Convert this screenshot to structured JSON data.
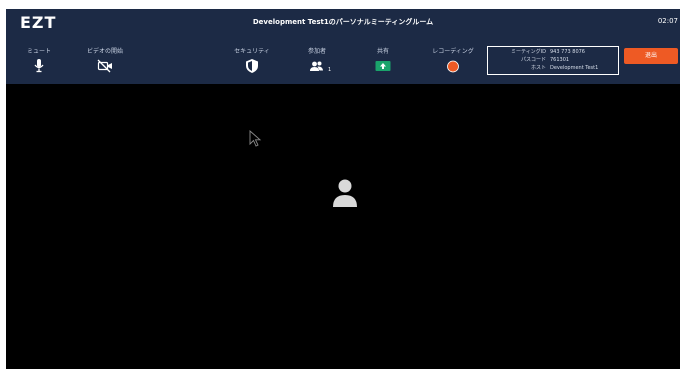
{
  "window": {
    "logo": "EZT",
    "title": "Development Test1のパーソナルミーティングルーム",
    "clock": "02:07"
  },
  "toolbar": {
    "mute_label": "ミュート",
    "video_label": "ビデオの開始",
    "security_label": "セキュリティ",
    "participants_label": "参加者",
    "participants_count": "1",
    "share_label": "共有",
    "recording_label": "レコーディング",
    "leave_label": "退出"
  },
  "meeting_info": {
    "id_key": "ミーティングID",
    "id_value": "943 773 8076",
    "passcode_key": "パスコード",
    "passcode_value": "761301",
    "host_key": "ホスト",
    "host_value": "Development Test1"
  },
  "colors": {
    "toolbar_bg": "#1c2a45",
    "stage_bg": "#000000",
    "share_green": "#1aa36b",
    "record_red": "#ee5a24",
    "leave_orange": "#ee5a24"
  },
  "icons": {
    "mute": "microphone-icon",
    "video": "video-off-icon",
    "security": "shield-icon",
    "participants": "people-icon",
    "share": "share-screen-icon",
    "recording": "record-dot-icon",
    "avatar": "user-avatar-icon",
    "cursor": "mouse-cursor-icon"
  }
}
